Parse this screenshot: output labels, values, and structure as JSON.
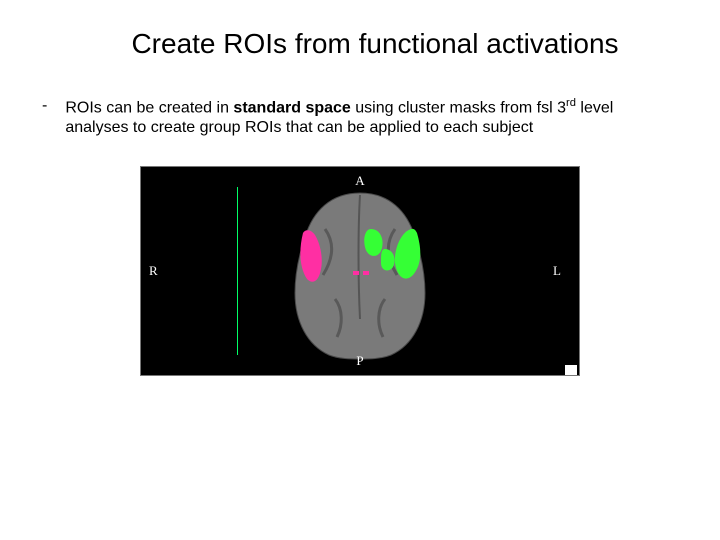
{
  "title": "Create ROIs from functional activations",
  "bullet": {
    "prefix": "ROIs can be created in ",
    "bold": "standard space",
    "mid": " using cluster masks from fsl 3",
    "sup": "rd",
    "suffix": " level analyses to create group ROIs that can be applied to each subject"
  },
  "figure": {
    "orientation_labels": {
      "a": "A",
      "p": "P",
      "r": "R",
      "l": "L"
    },
    "cluster_left_color": "#ff2fa3",
    "cluster_right_color": "#35ff35",
    "brain_fill": "#7a7a7a"
  }
}
